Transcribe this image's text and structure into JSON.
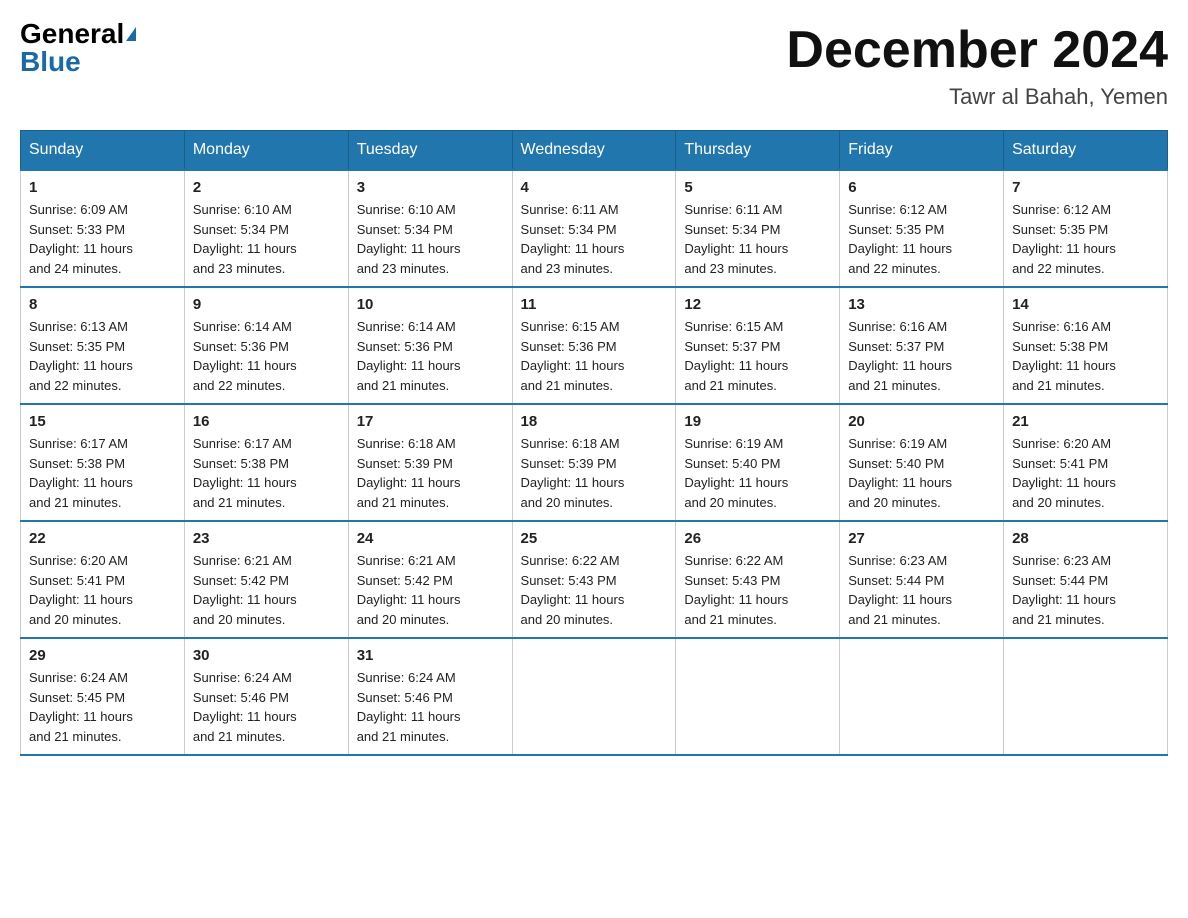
{
  "header": {
    "logo_general": "General",
    "logo_blue": "Blue",
    "month_title": "December 2024",
    "location": "Tawr al Bahah, Yemen"
  },
  "days_of_week": [
    "Sunday",
    "Monday",
    "Tuesday",
    "Wednesday",
    "Thursday",
    "Friday",
    "Saturday"
  ],
  "weeks": [
    [
      {
        "day": "1",
        "sunrise": "6:09 AM",
        "sunset": "5:33 PM",
        "daylight": "11 hours and 24 minutes."
      },
      {
        "day": "2",
        "sunrise": "6:10 AM",
        "sunset": "5:34 PM",
        "daylight": "11 hours and 23 minutes."
      },
      {
        "day": "3",
        "sunrise": "6:10 AM",
        "sunset": "5:34 PM",
        "daylight": "11 hours and 23 minutes."
      },
      {
        "day": "4",
        "sunrise": "6:11 AM",
        "sunset": "5:34 PM",
        "daylight": "11 hours and 23 minutes."
      },
      {
        "day": "5",
        "sunrise": "6:11 AM",
        "sunset": "5:34 PM",
        "daylight": "11 hours and 23 minutes."
      },
      {
        "day": "6",
        "sunrise": "6:12 AM",
        "sunset": "5:35 PM",
        "daylight": "11 hours and 22 minutes."
      },
      {
        "day": "7",
        "sunrise": "6:12 AM",
        "sunset": "5:35 PM",
        "daylight": "11 hours and 22 minutes."
      }
    ],
    [
      {
        "day": "8",
        "sunrise": "6:13 AM",
        "sunset": "5:35 PM",
        "daylight": "11 hours and 22 minutes."
      },
      {
        "day": "9",
        "sunrise": "6:14 AM",
        "sunset": "5:36 PM",
        "daylight": "11 hours and 22 minutes."
      },
      {
        "day": "10",
        "sunrise": "6:14 AM",
        "sunset": "5:36 PM",
        "daylight": "11 hours and 21 minutes."
      },
      {
        "day": "11",
        "sunrise": "6:15 AM",
        "sunset": "5:36 PM",
        "daylight": "11 hours and 21 minutes."
      },
      {
        "day": "12",
        "sunrise": "6:15 AM",
        "sunset": "5:37 PM",
        "daylight": "11 hours and 21 minutes."
      },
      {
        "day": "13",
        "sunrise": "6:16 AM",
        "sunset": "5:37 PM",
        "daylight": "11 hours and 21 minutes."
      },
      {
        "day": "14",
        "sunrise": "6:16 AM",
        "sunset": "5:38 PM",
        "daylight": "11 hours and 21 minutes."
      }
    ],
    [
      {
        "day": "15",
        "sunrise": "6:17 AM",
        "sunset": "5:38 PM",
        "daylight": "11 hours and 21 minutes."
      },
      {
        "day": "16",
        "sunrise": "6:17 AM",
        "sunset": "5:38 PM",
        "daylight": "11 hours and 21 minutes."
      },
      {
        "day": "17",
        "sunrise": "6:18 AM",
        "sunset": "5:39 PM",
        "daylight": "11 hours and 21 minutes."
      },
      {
        "day": "18",
        "sunrise": "6:18 AM",
        "sunset": "5:39 PM",
        "daylight": "11 hours and 20 minutes."
      },
      {
        "day": "19",
        "sunrise": "6:19 AM",
        "sunset": "5:40 PM",
        "daylight": "11 hours and 20 minutes."
      },
      {
        "day": "20",
        "sunrise": "6:19 AM",
        "sunset": "5:40 PM",
        "daylight": "11 hours and 20 minutes."
      },
      {
        "day": "21",
        "sunrise": "6:20 AM",
        "sunset": "5:41 PM",
        "daylight": "11 hours and 20 minutes."
      }
    ],
    [
      {
        "day": "22",
        "sunrise": "6:20 AM",
        "sunset": "5:41 PM",
        "daylight": "11 hours and 20 minutes."
      },
      {
        "day": "23",
        "sunrise": "6:21 AM",
        "sunset": "5:42 PM",
        "daylight": "11 hours and 20 minutes."
      },
      {
        "day": "24",
        "sunrise": "6:21 AM",
        "sunset": "5:42 PM",
        "daylight": "11 hours and 20 minutes."
      },
      {
        "day": "25",
        "sunrise": "6:22 AM",
        "sunset": "5:43 PM",
        "daylight": "11 hours and 20 minutes."
      },
      {
        "day": "26",
        "sunrise": "6:22 AM",
        "sunset": "5:43 PM",
        "daylight": "11 hours and 21 minutes."
      },
      {
        "day": "27",
        "sunrise": "6:23 AM",
        "sunset": "5:44 PM",
        "daylight": "11 hours and 21 minutes."
      },
      {
        "day": "28",
        "sunrise": "6:23 AM",
        "sunset": "5:44 PM",
        "daylight": "11 hours and 21 minutes."
      }
    ],
    [
      {
        "day": "29",
        "sunrise": "6:24 AM",
        "sunset": "5:45 PM",
        "daylight": "11 hours and 21 minutes."
      },
      {
        "day": "30",
        "sunrise": "6:24 AM",
        "sunset": "5:46 PM",
        "daylight": "11 hours and 21 minutes."
      },
      {
        "day": "31",
        "sunrise": "6:24 AM",
        "sunset": "5:46 PM",
        "daylight": "11 hours and 21 minutes."
      },
      null,
      null,
      null,
      null
    ]
  ],
  "labels": {
    "sunrise": "Sunrise:",
    "sunset": "Sunset:",
    "daylight": "Daylight:"
  }
}
